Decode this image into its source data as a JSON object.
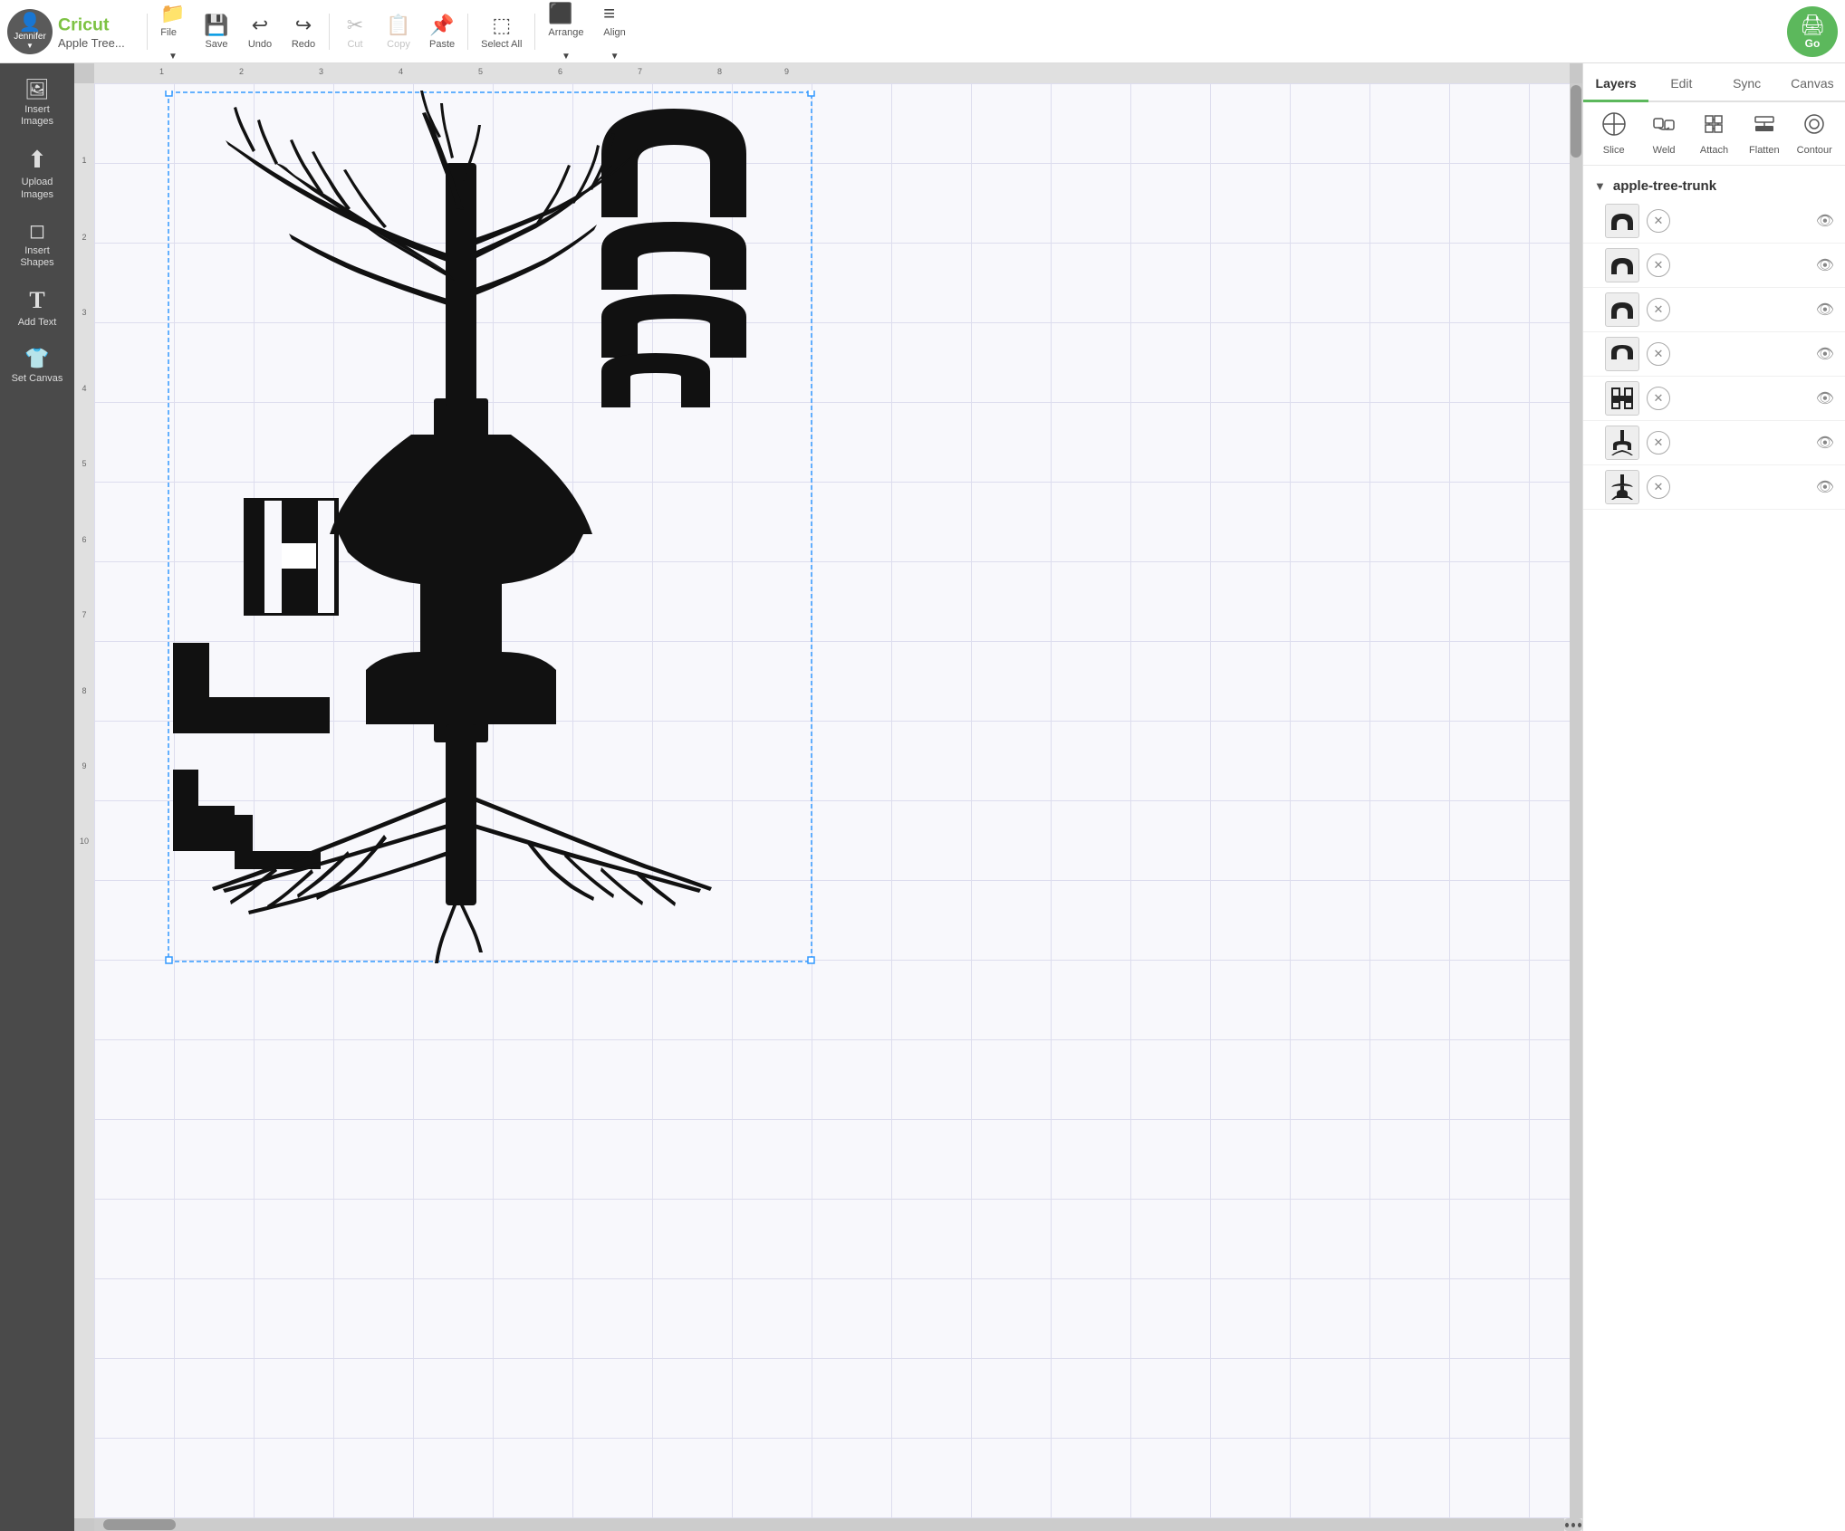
{
  "toolbar": {
    "user_name": "Jennifer",
    "project_title": "Apple Tree...",
    "file_label": "File",
    "save_label": "Save",
    "undo_label": "Undo",
    "redo_label": "Redo",
    "cut_label": "Cut",
    "copy_label": "Copy",
    "paste_label": "Paste",
    "select_all_label": "Select All",
    "arrange_label": "Arrange",
    "align_label": "Align",
    "go_label": "Go"
  },
  "sidebar": {
    "items": [
      {
        "id": "insert-images",
        "icon": "🖼",
        "label": "Insert\nImages"
      },
      {
        "id": "upload-images",
        "icon": "☁",
        "label": "Upload\nImages"
      },
      {
        "id": "insert-shapes",
        "icon": "◻",
        "label": "Insert\nShapes"
      },
      {
        "id": "add-text",
        "icon": "T",
        "label": "Add Text"
      },
      {
        "id": "set-canvas",
        "icon": "👕",
        "label": "Set Canvas"
      }
    ]
  },
  "right_panel": {
    "tabs": [
      {
        "id": "layers",
        "label": "Layers",
        "active": true
      },
      {
        "id": "edit",
        "label": "Edit",
        "active": false
      },
      {
        "id": "sync",
        "label": "Sync",
        "active": false
      },
      {
        "id": "canvas",
        "label": "Canvas",
        "active": false
      }
    ],
    "tools": [
      {
        "id": "slice",
        "icon": "⬡",
        "label": "Slice",
        "disabled": false
      },
      {
        "id": "weld",
        "icon": "⬡",
        "label": "Weld",
        "disabled": false
      },
      {
        "id": "attach",
        "icon": "📎",
        "label": "Attach",
        "disabled": false
      },
      {
        "id": "flatten",
        "icon": "⬛",
        "label": "Flatten",
        "disabled": false
      },
      {
        "id": "contour",
        "icon": "◯",
        "label": "Contour",
        "disabled": false
      }
    ],
    "layer_group_name": "apple-tree-trunk",
    "layers": [
      {
        "id": 1,
        "thumb": "arch-top"
      },
      {
        "id": 2,
        "thumb": "arch-top"
      },
      {
        "id": 3,
        "thumb": "arch-top"
      },
      {
        "id": 4,
        "thumb": "arch-bottom"
      },
      {
        "id": 5,
        "thumb": "h-shape"
      },
      {
        "id": 6,
        "thumb": "tree-roots"
      },
      {
        "id": 7,
        "thumb": "tree-full"
      }
    ]
  },
  "rulers": {
    "h_labels": [
      "1",
      "2",
      "3",
      "4",
      "5",
      "6",
      "7",
      "8",
      "9"
    ],
    "v_labels": [
      "1",
      "2",
      "3",
      "4",
      "5",
      "6",
      "7",
      "8",
      "9",
      "10"
    ]
  }
}
